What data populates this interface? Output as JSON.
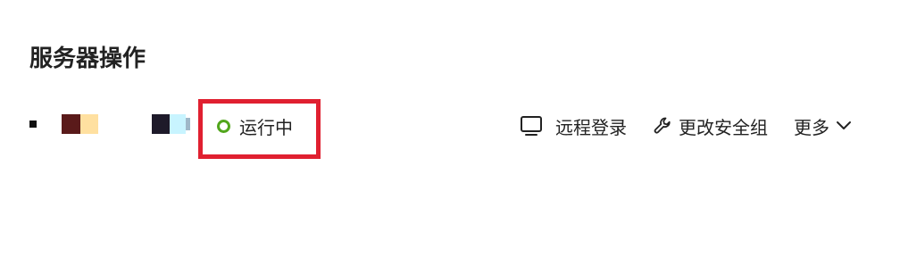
{
  "section": {
    "title": "服务器操作"
  },
  "instance": {
    "status_text": "运行中",
    "status_color": "#52a61d",
    "redacted_name_colors": [
      "#111111",
      "#5a1a1a",
      "#ffe0a0",
      "#1e1a2a",
      "#c8f4ff"
    ]
  },
  "actions": {
    "remote_login": {
      "label": "远程登录",
      "icon": "monitor-icon"
    },
    "change_security_group": {
      "label": "更改安全组",
      "icon": "wrench-icon"
    },
    "more": {
      "label": "更多",
      "icon": "chevron-down-icon"
    }
  },
  "annotation": {
    "highlight_color": "#e02030"
  }
}
